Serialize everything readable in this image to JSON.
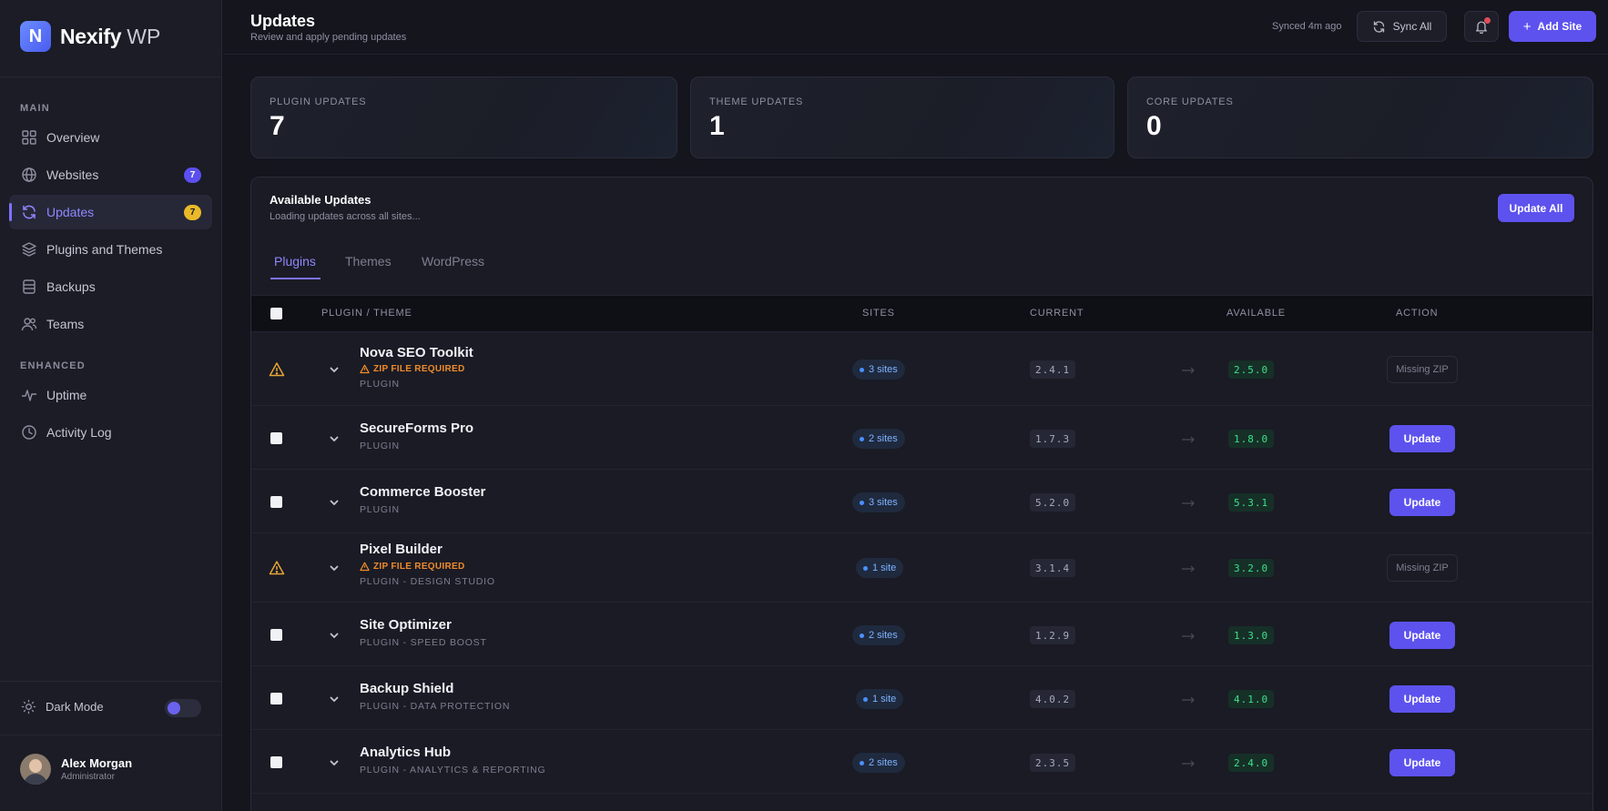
{
  "brand": {
    "name": "Nexify",
    "suffix": "WP",
    "logo_letter": "N"
  },
  "sidebar": {
    "sections": [
      {
        "label": "MAIN"
      },
      {
        "label": "ENHANCED"
      }
    ],
    "items": [
      {
        "label": "Overview",
        "icon": "grid-icon"
      },
      {
        "label": "Websites",
        "icon": "globe-icon",
        "badge": "7"
      },
      {
        "label": "Updates",
        "icon": "refresh-icon",
        "badge": "7",
        "active": true
      },
      {
        "label": "Plugins and Themes",
        "icon": "layers-icon"
      },
      {
        "label": "Backups",
        "icon": "database-icon"
      },
      {
        "label": "Teams",
        "icon": "users-icon"
      },
      {
        "label": "Uptime",
        "icon": "pulse-icon"
      },
      {
        "label": "Activity Log",
        "icon": "clock-icon"
      }
    ],
    "dark_mode_label": "Dark Mode",
    "dark_mode_enabled": true,
    "user": {
      "name": "Alex Morgan",
      "role": "Administrator"
    }
  },
  "header": {
    "title": "Updates",
    "subtitle": "Review and apply pending updates",
    "synced": "Synced 4m ago",
    "sync_label": "Sync All",
    "add_label": "Add Site"
  },
  "stats": [
    {
      "label": "PLUGIN UPDATES",
      "value": "7"
    },
    {
      "label": "THEME UPDATES",
      "value": "1"
    },
    {
      "label": "CORE UPDATES",
      "value": "0"
    }
  ],
  "panel": {
    "title": "Available Updates",
    "subtitle": "Loading updates across all sites...",
    "update_all_label": "Update All",
    "tabs": [
      {
        "label": "Plugins",
        "active": true
      },
      {
        "label": "Themes"
      },
      {
        "label": "WordPress"
      }
    ],
    "columns": [
      "PLUGIN / THEME",
      "SITES",
      "CURRENT",
      "AVAILABLE",
      "ACTION"
    ],
    "zip_warning": "ZIP FILE REQUIRED",
    "update_label": "Update",
    "missing_label": "Missing ZIP",
    "rows": [
      {
        "name": "Nova SEO Toolkit",
        "type": "PLUGIN",
        "zip": true,
        "sites": "3 sites",
        "current": "2.4.1",
        "available": "2.5.0"
      },
      {
        "name": "SecureForms Pro",
        "type": "PLUGIN",
        "zip": false,
        "sites": "2 sites",
        "current": "1.7.3",
        "available": "1.8.0"
      },
      {
        "name": "Commerce Booster",
        "type": "PLUGIN",
        "zip": false,
        "sites": "3 sites",
        "current": "5.2.0",
        "available": "5.3.1"
      },
      {
        "name": "Pixel Builder",
        "type": "PLUGIN - DESIGN STUDIO",
        "zip": true,
        "sites": "1 site",
        "current": "3.1.4",
        "available": "3.2.0"
      },
      {
        "name": "Site Optimizer",
        "type": "PLUGIN - SPEED BOOST",
        "zip": false,
        "sites": "2 sites",
        "current": "1.2.9",
        "available": "1.3.0"
      },
      {
        "name": "Backup Shield",
        "type": "PLUGIN - DATA PROTECTION",
        "zip": false,
        "sites": "1 site",
        "current": "4.0.2",
        "available": "4.1.0"
      },
      {
        "name": "Analytics Hub",
        "type": "PLUGIN - ANALYTICS & REPORTING",
        "zip": false,
        "sites": "2 sites",
        "current": "2.3.5",
        "available": "2.4.0"
      }
    ]
  },
  "colors": {
    "accent": "#5d52ee",
    "available": "#3ee08a",
    "warning": "#f08b2c",
    "badge_yellow": "#e9b928"
  }
}
